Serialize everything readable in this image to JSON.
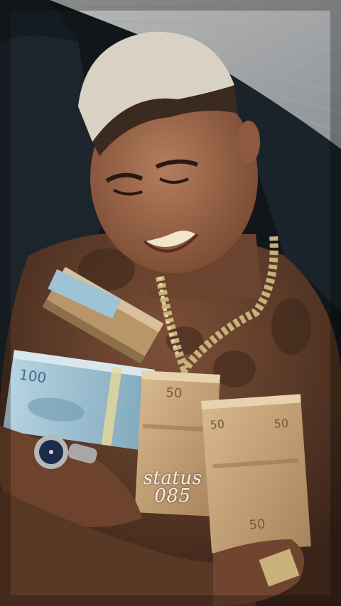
{
  "overlay": {
    "line1": "status",
    "line2": "085"
  },
  "colors": {
    "background": "#0e1114",
    "sofa": "#1d262c",
    "skin": "#8a5a40",
    "hair": "#d9d2c4",
    "chain": "#c9b27a",
    "banknote_blue": "#9fc3d6",
    "banknote_brown": "#c8a57c",
    "watermark_text": "#f4efe6"
  }
}
